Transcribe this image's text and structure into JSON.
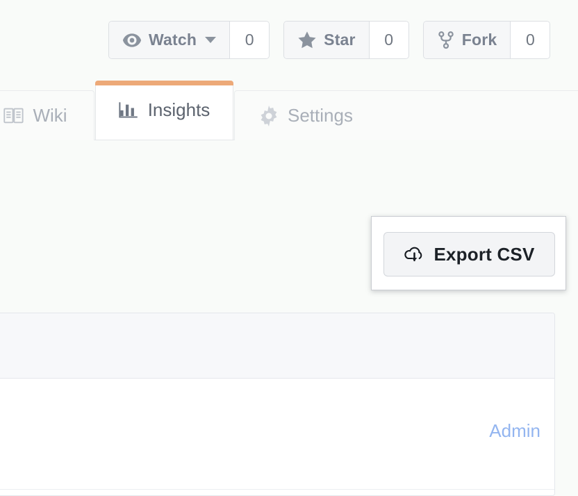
{
  "colors": {
    "page_bg": "#f9fbf9",
    "active_tab_accent": "#eda978",
    "link_blue": "#93b5f0",
    "panel_header_bg": "#f7f8fa",
    "button_bg": "#f6f7f8",
    "text_muted": "#a9afb8"
  },
  "repo_actions": [
    {
      "icon": "eye-icon",
      "label": "Watch",
      "count": "0",
      "has_dropdown": true
    },
    {
      "icon": "star-icon",
      "label": "Star",
      "count": "0",
      "has_dropdown": false
    },
    {
      "icon": "repo-forked-icon",
      "label": "Fork",
      "count": "0",
      "has_dropdown": false
    }
  ],
  "tabs": [
    {
      "id": "wiki",
      "icon": "book-icon",
      "label": "Wiki",
      "active": false
    },
    {
      "id": "insights",
      "icon": "bar-chart-icon",
      "label": "Insights",
      "active": true
    },
    {
      "id": "settings",
      "icon": "gear-icon",
      "label": "Settings",
      "active": false
    }
  ],
  "export": {
    "icon": "cloud-download-icon",
    "label": "Export CSV"
  },
  "panel": {
    "row": {
      "link_label": "Admin"
    }
  }
}
